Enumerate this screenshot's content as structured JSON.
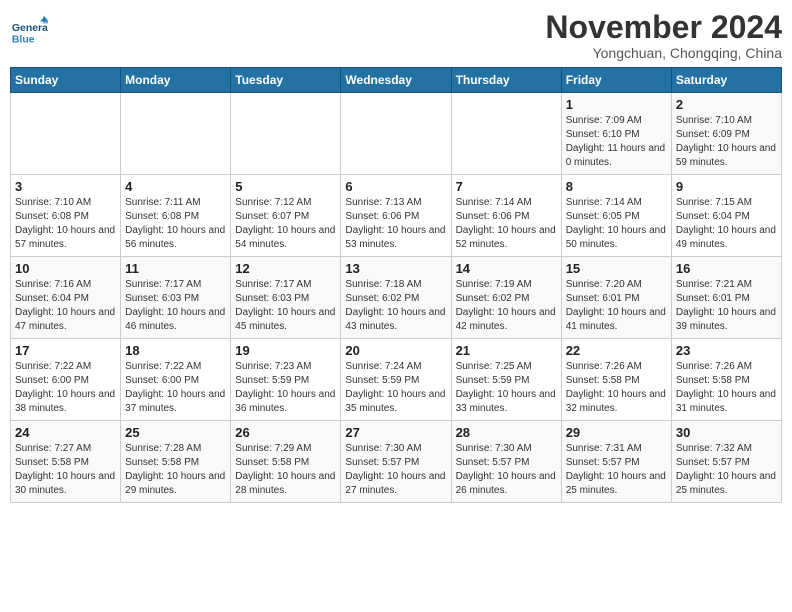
{
  "logo": {
    "general": "General",
    "blue": "Blue"
  },
  "title": "November 2024",
  "subtitle": "Yongchuan, Chongqing, China",
  "weekdays": [
    "Sunday",
    "Monday",
    "Tuesday",
    "Wednesday",
    "Thursday",
    "Friday",
    "Saturday"
  ],
  "weeks": [
    [
      {
        "day": "",
        "info": ""
      },
      {
        "day": "",
        "info": ""
      },
      {
        "day": "",
        "info": ""
      },
      {
        "day": "",
        "info": ""
      },
      {
        "day": "",
        "info": ""
      },
      {
        "day": "1",
        "info": "Sunrise: 7:09 AM\nSunset: 6:10 PM\nDaylight: 11 hours and 0 minutes."
      },
      {
        "day": "2",
        "info": "Sunrise: 7:10 AM\nSunset: 6:09 PM\nDaylight: 10 hours and 59 minutes."
      }
    ],
    [
      {
        "day": "3",
        "info": "Sunrise: 7:10 AM\nSunset: 6:08 PM\nDaylight: 10 hours and 57 minutes."
      },
      {
        "day": "4",
        "info": "Sunrise: 7:11 AM\nSunset: 6:08 PM\nDaylight: 10 hours and 56 minutes."
      },
      {
        "day": "5",
        "info": "Sunrise: 7:12 AM\nSunset: 6:07 PM\nDaylight: 10 hours and 54 minutes."
      },
      {
        "day": "6",
        "info": "Sunrise: 7:13 AM\nSunset: 6:06 PM\nDaylight: 10 hours and 53 minutes."
      },
      {
        "day": "7",
        "info": "Sunrise: 7:14 AM\nSunset: 6:06 PM\nDaylight: 10 hours and 52 minutes."
      },
      {
        "day": "8",
        "info": "Sunrise: 7:14 AM\nSunset: 6:05 PM\nDaylight: 10 hours and 50 minutes."
      },
      {
        "day": "9",
        "info": "Sunrise: 7:15 AM\nSunset: 6:04 PM\nDaylight: 10 hours and 49 minutes."
      }
    ],
    [
      {
        "day": "10",
        "info": "Sunrise: 7:16 AM\nSunset: 6:04 PM\nDaylight: 10 hours and 47 minutes."
      },
      {
        "day": "11",
        "info": "Sunrise: 7:17 AM\nSunset: 6:03 PM\nDaylight: 10 hours and 46 minutes."
      },
      {
        "day": "12",
        "info": "Sunrise: 7:17 AM\nSunset: 6:03 PM\nDaylight: 10 hours and 45 minutes."
      },
      {
        "day": "13",
        "info": "Sunrise: 7:18 AM\nSunset: 6:02 PM\nDaylight: 10 hours and 43 minutes."
      },
      {
        "day": "14",
        "info": "Sunrise: 7:19 AM\nSunset: 6:02 PM\nDaylight: 10 hours and 42 minutes."
      },
      {
        "day": "15",
        "info": "Sunrise: 7:20 AM\nSunset: 6:01 PM\nDaylight: 10 hours and 41 minutes."
      },
      {
        "day": "16",
        "info": "Sunrise: 7:21 AM\nSunset: 6:01 PM\nDaylight: 10 hours and 39 minutes."
      }
    ],
    [
      {
        "day": "17",
        "info": "Sunrise: 7:22 AM\nSunset: 6:00 PM\nDaylight: 10 hours and 38 minutes."
      },
      {
        "day": "18",
        "info": "Sunrise: 7:22 AM\nSunset: 6:00 PM\nDaylight: 10 hours and 37 minutes."
      },
      {
        "day": "19",
        "info": "Sunrise: 7:23 AM\nSunset: 5:59 PM\nDaylight: 10 hours and 36 minutes."
      },
      {
        "day": "20",
        "info": "Sunrise: 7:24 AM\nSunset: 5:59 PM\nDaylight: 10 hours and 35 minutes."
      },
      {
        "day": "21",
        "info": "Sunrise: 7:25 AM\nSunset: 5:59 PM\nDaylight: 10 hours and 33 minutes."
      },
      {
        "day": "22",
        "info": "Sunrise: 7:26 AM\nSunset: 5:58 PM\nDaylight: 10 hours and 32 minutes."
      },
      {
        "day": "23",
        "info": "Sunrise: 7:26 AM\nSunset: 5:58 PM\nDaylight: 10 hours and 31 minutes."
      }
    ],
    [
      {
        "day": "24",
        "info": "Sunrise: 7:27 AM\nSunset: 5:58 PM\nDaylight: 10 hours and 30 minutes."
      },
      {
        "day": "25",
        "info": "Sunrise: 7:28 AM\nSunset: 5:58 PM\nDaylight: 10 hours and 29 minutes."
      },
      {
        "day": "26",
        "info": "Sunrise: 7:29 AM\nSunset: 5:58 PM\nDaylight: 10 hours and 28 minutes."
      },
      {
        "day": "27",
        "info": "Sunrise: 7:30 AM\nSunset: 5:57 PM\nDaylight: 10 hours and 27 minutes."
      },
      {
        "day": "28",
        "info": "Sunrise: 7:30 AM\nSunset: 5:57 PM\nDaylight: 10 hours and 26 minutes."
      },
      {
        "day": "29",
        "info": "Sunrise: 7:31 AM\nSunset: 5:57 PM\nDaylight: 10 hours and 25 minutes."
      },
      {
        "day": "30",
        "info": "Sunrise: 7:32 AM\nSunset: 5:57 PM\nDaylight: 10 hours and 25 minutes."
      }
    ]
  ]
}
